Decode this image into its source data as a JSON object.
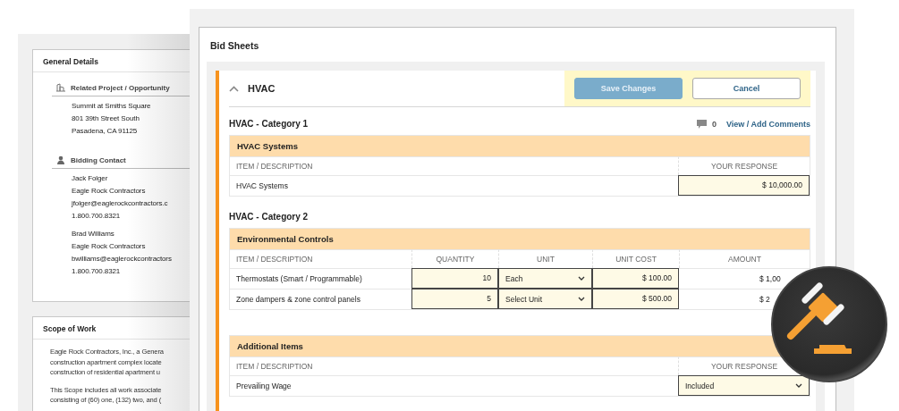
{
  "side_panel": {
    "cards": [
      {
        "title": "General Details",
        "groups": [
          {
            "kind": "project",
            "label": "Related Project / Opportunity",
            "blocks": [
              [
                "Summit at Smiths Square",
                "801 39th Street South",
                "Pasadena, CA 91125"
              ]
            ]
          },
          {
            "kind": "contact",
            "label": "Bidding Contact",
            "blocks": [
              [
                "Jack Folger",
                "Eagle Rock Contractors",
                "jfolger@eaglerockcontractors.c",
                "1.800.700.8321"
              ],
              [
                "Brad Williams",
                "Eagle Rock Contractors",
                "bwilliams@eaglerockcontractors",
                "1.800.700.8321"
              ]
            ]
          }
        ]
      },
      {
        "title": "Scope of Work",
        "paragraphs": [
          [
            "Eagle Rock Contractors, Inc., a Genera",
            "construction apartment complex locate",
            "construction of residential apartment u"
          ],
          [
            "This Scope includes all work associate",
            "consisting of (60) one, (132) two, and ("
          ]
        ]
      }
    ]
  },
  "bid_sheets": {
    "title": "Bid Sheets",
    "section": {
      "title": "HVAC",
      "expanded": true,
      "buttons": [
        {
          "label": "Save Changes",
          "kind": "primary",
          "disabled": true
        },
        {
          "label": "Cancel",
          "kind": "secondary",
          "disabled": false
        }
      ],
      "categories": [
        {
          "title": "HVAC - Category 1",
          "comments": {
            "count": "0",
            "link": "View / Add Comments"
          },
          "tables": [
            {
              "title": "HVAC Systems",
              "columns": [
                "ITEM / DESCRIPTION",
                "YOUR RESPONSE"
              ],
              "rows": [
                [
                  {
                    "kind": "text",
                    "value": "HVAC Systems"
                  },
                  {
                    "kind": "input",
                    "value": "$ 10,000.00"
                  }
                ]
              ]
            }
          ]
        },
        {
          "title": "HVAC - Category 2",
          "tables": [
            {
              "title": "Environmental Controls",
              "columns": [
                "ITEM / DESCRIPTION",
                "QUANTITY",
                "UNIT",
                "UNIT COST",
                "AMOUNT"
              ],
              "rows": [
                [
                  {
                    "kind": "text",
                    "value": "Thermostats (Smart / Programmable)"
                  },
                  {
                    "kind": "input",
                    "value": "10"
                  },
                  {
                    "kind": "select",
                    "value": "Each"
                  },
                  {
                    "kind": "input",
                    "value": "$ 100.00"
                  },
                  {
                    "kind": "amount",
                    "value": "$ 1,00"
                  }
                ],
                [
                  {
                    "kind": "text",
                    "value": "Zone dampers & zone control panels"
                  },
                  {
                    "kind": "input",
                    "value": "5"
                  },
                  {
                    "kind": "select",
                    "value": "Select Unit"
                  },
                  {
                    "kind": "input",
                    "value": "$ 500.00"
                  },
                  {
                    "kind": "amount",
                    "value": "$ 2"
                  }
                ]
              ]
            },
            {
              "title": "Additional Items",
              "columns": [
                "ITEM / DESCRIPTION",
                "YOUR RESPONSE"
              ],
              "rows": [
                [
                  {
                    "kind": "text",
                    "value": "Prevailing Wage"
                  },
                  {
                    "kind": "select",
                    "value": "Included"
                  }
                ]
              ]
            }
          ]
        }
      ]
    }
  }
}
